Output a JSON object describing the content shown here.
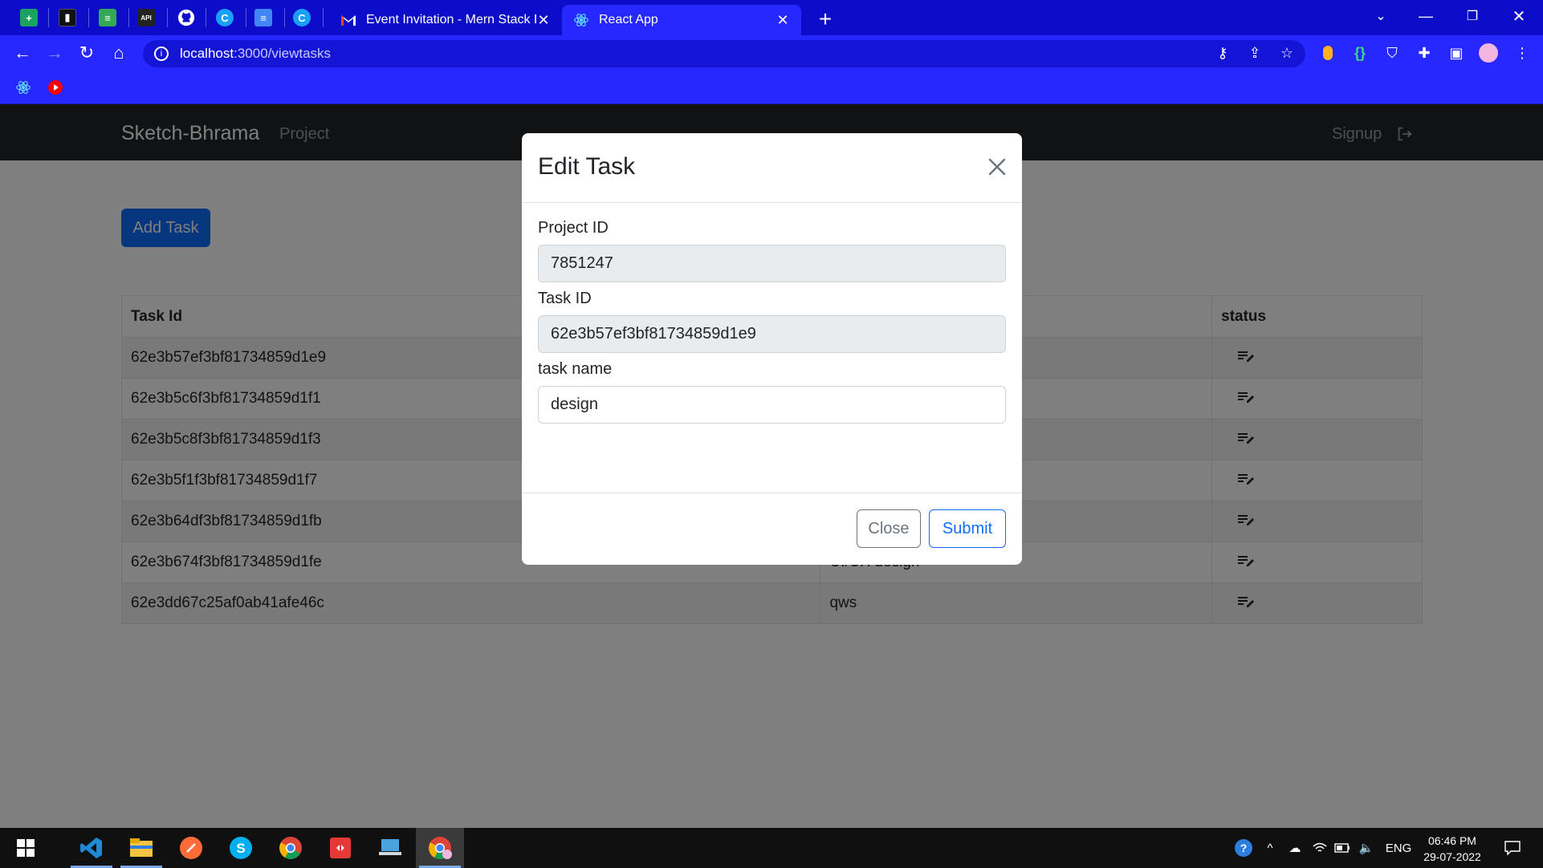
{
  "browser": {
    "tabs": [
      {
        "title": "Event Invitation - Mern Stack Dev",
        "icon": "gmail-icon",
        "active": false
      },
      {
        "title": "React App",
        "icon": "react-icon",
        "active": true
      }
    ],
    "url_host": "localhost",
    "url_path": ":3000/viewtasks"
  },
  "navbar": {
    "brand": "Sketch-Bhrama",
    "link_project": "Project",
    "link_signup": "Signup"
  },
  "page": {
    "add_task_label": "Add Task",
    "table": {
      "headers": {
        "task_id": "Task Id",
        "status": "status"
      },
      "rows": [
        {
          "task_id": "62e3b57ef3bf81734859d1e9",
          "task_name": ""
        },
        {
          "task_id": "62e3b5c6f3bf81734859d1f1",
          "task_name": ""
        },
        {
          "task_id": "62e3b5c8f3bf81734859d1f3",
          "task_name": ""
        },
        {
          "task_id": "62e3b5f1f3bf81734859d1f7",
          "task_name": ""
        },
        {
          "task_id": "62e3b64df3bf81734859d1fb",
          "task_name": ""
        },
        {
          "task_id": "62e3b674f3bf81734859d1fe",
          "task_name": "UI/UX design"
        },
        {
          "task_id": "62e3dd67c25af0ab41afe46c",
          "task_name": "qws"
        }
      ]
    }
  },
  "modal": {
    "title": "Edit Task",
    "project_id_label": "Project ID",
    "project_id_value": "7851247",
    "task_id_label": "Task ID",
    "task_id_value": "62e3b57ef3bf81734859d1e9",
    "task_name_label": "task name",
    "task_name_value": "design",
    "close_label": "Close",
    "submit_label": "Submit"
  },
  "taskbar": {
    "language": "ENG",
    "time": "06:46 PM",
    "date": "29-07-2022"
  },
  "colors": {
    "browser_frame": "#0c0cc9",
    "toolbar": "#2727ff",
    "navbar": "#212529",
    "primary": "#0d6efd"
  }
}
